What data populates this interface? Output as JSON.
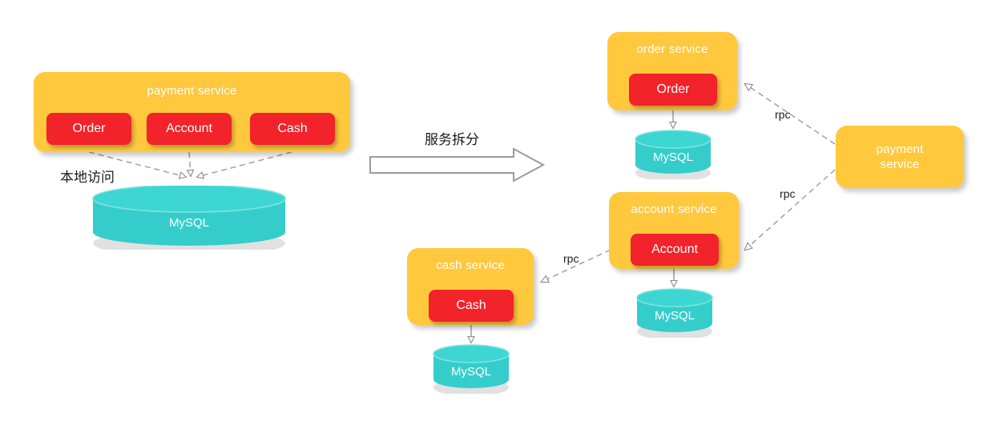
{
  "diagram": {
    "title_left": "payment service",
    "transition_label": "服务拆分",
    "local_access_label": "本地访问"
  },
  "monolith": {
    "service_name": "payment service",
    "components": [
      {
        "name": "Order"
      },
      {
        "name": "Account"
      },
      {
        "name": "Cash"
      }
    ],
    "database": {
      "label": "MySQL"
    },
    "access_label": "本地访问"
  },
  "transition": {
    "label": "服务拆分",
    "arrow_icon": "block-arrow-right-icon"
  },
  "microservices": {
    "order_service": {
      "title": "order service",
      "component": "Order",
      "database": "MySQL"
    },
    "account_service": {
      "title": "account service",
      "component": "Account",
      "database": "MySQL"
    },
    "cash_service": {
      "title": "cash service",
      "component": "Cash",
      "database": "MySQL"
    },
    "payment_service": {
      "title_line1": "payment",
      "title_line2": "service"
    },
    "rpc_labels": {
      "order": "rpc",
      "account": "rpc",
      "cash": "rpc"
    }
  },
  "colors": {
    "service_orange": "#ffc83d",
    "component_red": "#f2232a",
    "database_teal": "#35cdcb",
    "database_teal_top": "#3ed6d2",
    "edge_gray": "#9a9a9a",
    "text_white": "#ffffff",
    "text_dark": "#1a1a1a"
  }
}
